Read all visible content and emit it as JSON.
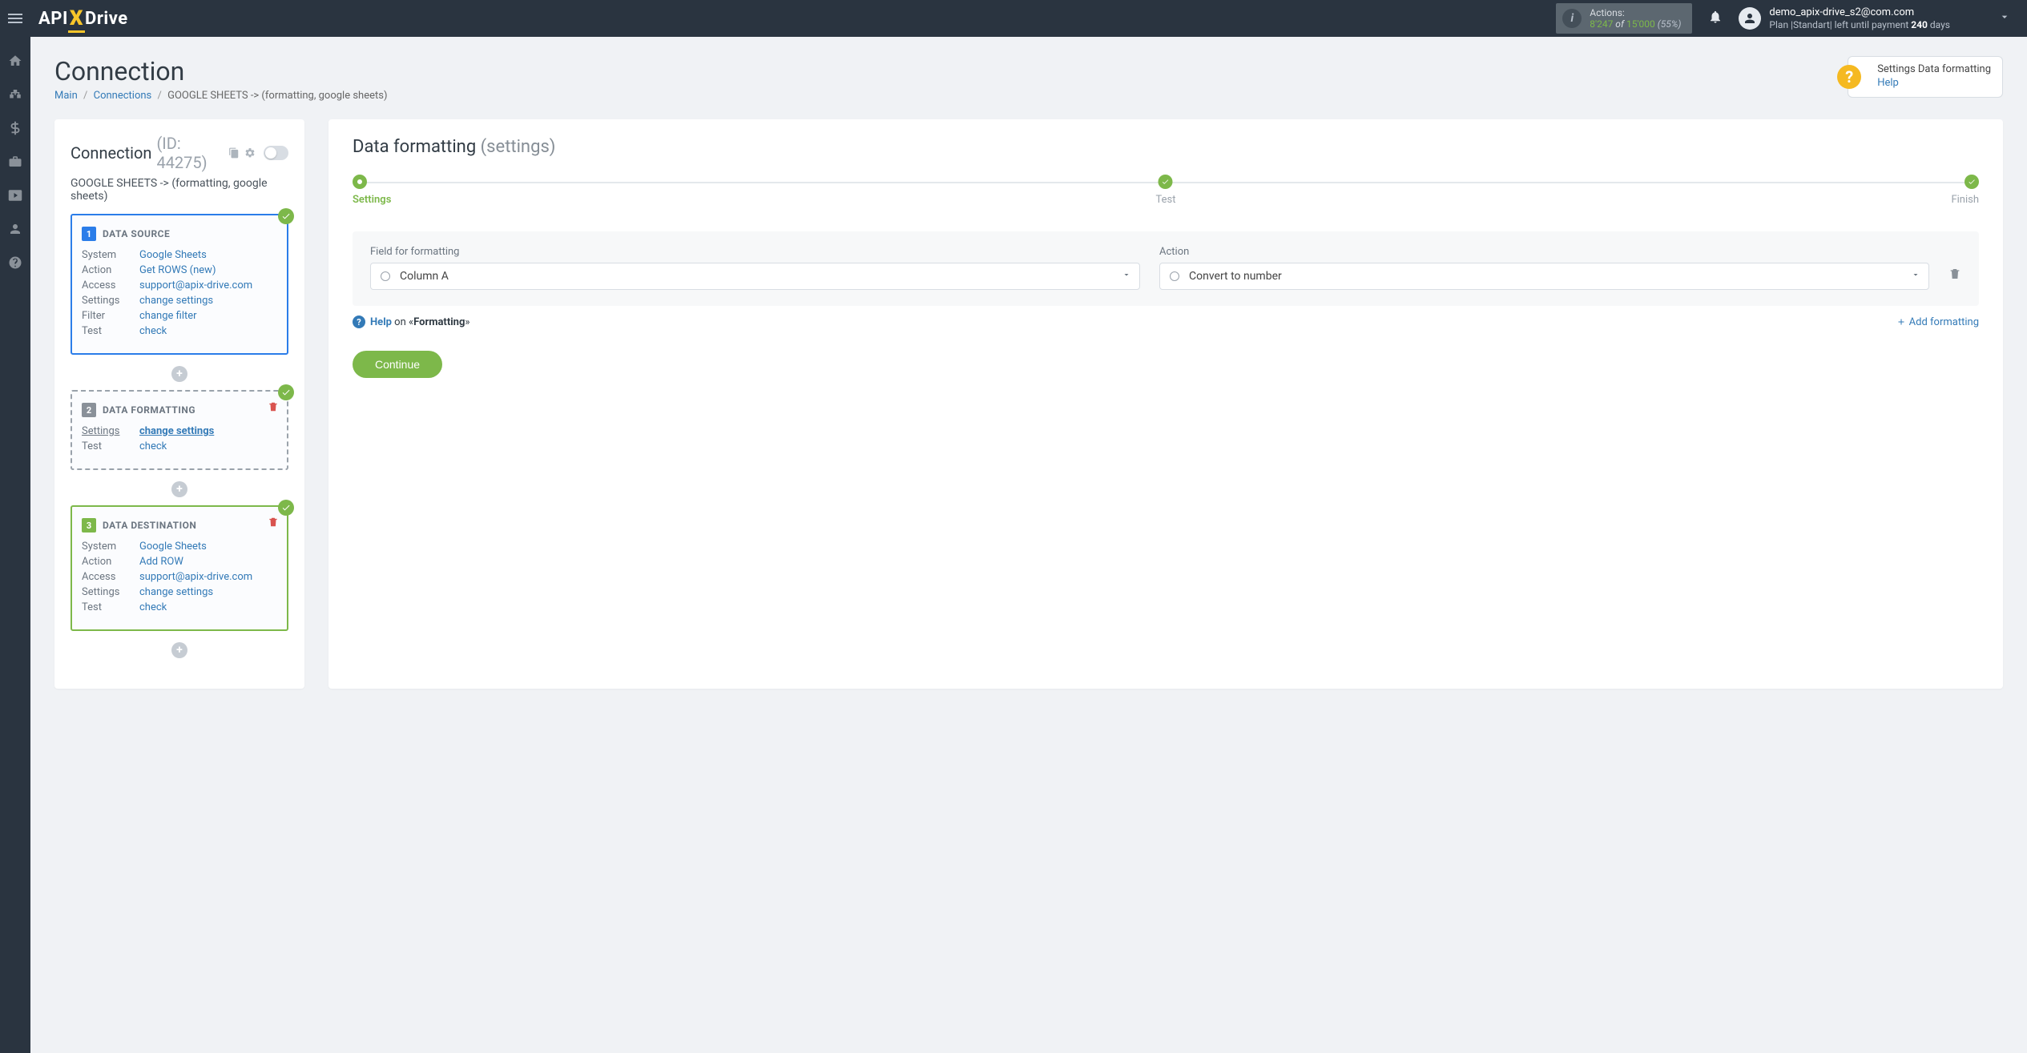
{
  "header": {
    "logo_api": "API",
    "logo_drive": "Drive",
    "actions_label": "Actions:",
    "actions_used": "8'247",
    "actions_of": " of ",
    "actions_total": "15'000",
    "actions_pct": "(55%)",
    "user_email": "demo_apix-drive_s2@com.com",
    "user_plan_prefix": "Plan |Standart| left until payment ",
    "user_plan_days": "240",
    "user_plan_suffix": " days"
  },
  "page": {
    "title": "Connection",
    "help_text": "Settings Data formatting",
    "help_link": "Help"
  },
  "breadcrumb": {
    "main": "Main",
    "connections": "Connections",
    "current": "GOOGLE SHEETS -> (formatting, google sheets)"
  },
  "left": {
    "title": "Connection",
    "id": "(ID: 44275)",
    "sub": "GOOGLE SHEETS -> (formatting, google sheets)",
    "source": {
      "label": "DATA SOURCE",
      "system_k": "System",
      "system_v": "Google Sheets",
      "action_k": "Action",
      "action_v": "Get ROWS (new)",
      "access_k": "Access",
      "access_v": "support@apix-drive.com",
      "settings_k": "Settings",
      "settings_v": "change settings",
      "filter_k": "Filter",
      "filter_v": "change filter",
      "test_k": "Test",
      "test_v": "check"
    },
    "format": {
      "label": "DATA FORMATTING",
      "settings_k": "Settings",
      "settings_v": "change settings",
      "test_k": "Test",
      "test_v": "check"
    },
    "dest": {
      "label": "DATA DESTINATION",
      "system_k": "System",
      "system_v": "Google Sheets",
      "action_k": "Action",
      "action_v": "Add ROW",
      "access_k": "Access",
      "access_v": "support@apix-drive.com",
      "settings_k": "Settings",
      "settings_v": "change settings",
      "test_k": "Test",
      "test_v": "check"
    }
  },
  "right": {
    "title_main": "Data formatting ",
    "title_sub": "(settings)",
    "step_settings": "Settings",
    "step_test": "Test",
    "step_finish": "Finish",
    "field_formatting_label": "Field for formatting",
    "field_formatting_value": "Column A",
    "action_label": "Action",
    "action_value": "Convert to number",
    "help_word": "Help",
    "help_on": " on «",
    "help_topic": "Formatting",
    "help_close": "»",
    "add_formatting": "Add formatting",
    "continue": "Continue"
  }
}
